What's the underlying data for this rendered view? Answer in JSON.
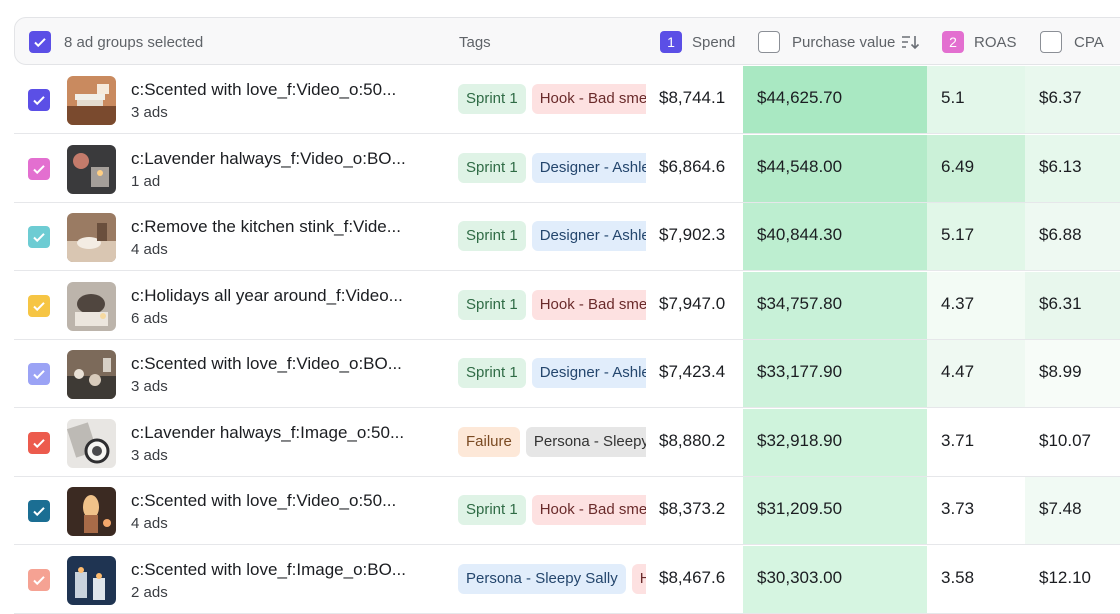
{
  "header": {
    "selection_label": "8 ad groups selected",
    "tags_label": "Tags",
    "spend_badge": "1",
    "spend_label": "Spend",
    "purchase_value_label": "Purchase value",
    "roas_badge": "2",
    "roas_label": "ROAS",
    "cpa_label": "CPA"
  },
  "colors": {
    "accent": "#5b4fe6",
    "roas_badge": "#e36fd0",
    "tag_sprint_bg": "#dff3e6",
    "tag_hook_bg": "#fde1e1",
    "tag_designer_bg": "#e1edfb",
    "tag_failure_bg": "#fde8d8",
    "tag_persona_bg": "#e6e6e6"
  },
  "rows": [
    {
      "name": "c:Scented with love_f:Video_o:50...",
      "ads": "3 ads",
      "check_color": "#5b4fe6",
      "thumb": "thumb-1",
      "tags": [
        {
          "label": "Sprint 1",
          "kind": "sprint"
        },
        {
          "label": "Hook - Bad smell",
          "kind": "hook"
        }
      ],
      "spend": "$8,744.1",
      "purchase_value": "$44,625.70",
      "roas": "5.1",
      "cpa": "$6.37"
    },
    {
      "name": "c:Lavender halways_f:Video_o:BO...",
      "ads": "1 ad",
      "check_color": "#e36fd0",
      "thumb": "thumb-2",
      "tags": [
        {
          "label": "Sprint 1",
          "kind": "sprint"
        },
        {
          "label": "Designer - Ashley",
          "kind": "designer"
        }
      ],
      "spend": "$6,864.6",
      "purchase_value": "$44,548.00",
      "roas": "6.49",
      "cpa": "$6.13"
    },
    {
      "name": "c:Remove the kitchen stink_f:Vide...",
      "ads": "4 ads",
      "check_color": "#6dccd3",
      "thumb": "thumb-3",
      "tags": [
        {
          "label": "Sprint 1",
          "kind": "sprint"
        },
        {
          "label": "Designer - Ashley",
          "kind": "designer"
        }
      ],
      "spend": "$7,902.3",
      "purchase_value": "$40,844.30",
      "roas": "5.17",
      "cpa": "$6.88"
    },
    {
      "name": "c:Holidays all year around_f:Video...",
      "ads": "6 ads",
      "check_color": "#f6c544",
      "thumb": "thumb-4",
      "tags": [
        {
          "label": "Sprint 1",
          "kind": "sprint"
        },
        {
          "label": "Hook - Bad smell",
          "kind": "hook"
        }
      ],
      "spend": "$7,947.0",
      "purchase_value": "$34,757.80",
      "roas": "4.37",
      "cpa": "$6.31"
    },
    {
      "name": "c:Scented with love_f:Video_o:BO...",
      "ads": "3 ads",
      "check_color": "#9ba3f5",
      "thumb": "thumb-5",
      "tags": [
        {
          "label": "Sprint 1",
          "kind": "sprint"
        },
        {
          "label": "Designer - Ashley",
          "kind": "designer"
        }
      ],
      "spend": "$7,423.4",
      "purchase_value": "$33,177.90",
      "roas": "4.47",
      "cpa": "$8.99"
    },
    {
      "name": "c:Lavender halways_f:Image_o:50...",
      "ads": "3 ads",
      "check_color": "#ec5b4d",
      "thumb": "thumb-6",
      "tags": [
        {
          "label": "Failure",
          "kind": "failure"
        },
        {
          "label": "Persona - Sleepy Sally",
          "kind": "persona"
        }
      ],
      "spend": "$8,880.2",
      "purchase_value": "$32,918.90",
      "roas": "3.71",
      "cpa": "$10.07"
    },
    {
      "name": "c:Scented with love_f:Video_o:50...",
      "ads": "4 ads",
      "check_color": "#1b6e93",
      "thumb": "thumb-7",
      "tags": [
        {
          "label": "Sprint 1",
          "kind": "sprint"
        },
        {
          "label": "Hook - Bad smell",
          "kind": "hook"
        }
      ],
      "spend": "$8,373.2",
      "purchase_value": "$31,209.50",
      "roas": "3.73",
      "cpa": "$7.48"
    },
    {
      "name": "c:Scented with love_f:Image_o:BO...",
      "ads": "2 ads",
      "check_color": "#f5a293",
      "thumb": "thumb-8",
      "tags": [
        {
          "label": "Persona - Sleepy Sally",
          "kind": "designer"
        },
        {
          "label": "Hook - Bad smell",
          "kind": "hook"
        }
      ],
      "spend": "$8,467.6",
      "purchase_value": "$30,303.00",
      "roas": "3.58",
      "cpa": "$12.10"
    }
  ]
}
